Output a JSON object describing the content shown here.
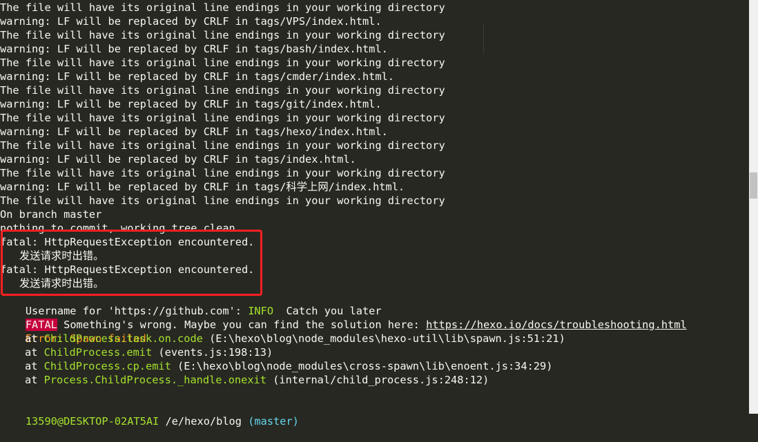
{
  "terminal": {
    "lines": [
      "The file will have its original line endings in your working directory",
      "warning: LF will be replaced by CRLF in tags/VPS/index.html.",
      "The file will have its original line endings in your working directory",
      "warning: LF will be replaced by CRLF in tags/bash/index.html.",
      "The file will have its original line endings in your working directory",
      "warning: LF will be replaced by CRLF in tags/cmder/index.html.",
      "The file will have its original line endings in your working directory",
      "warning: LF will be replaced by CRLF in tags/git/index.html.",
      "The file will have its original line endings in your working directory",
      "warning: LF will be replaced by CRLF in tags/hexo/index.html.",
      "The file will have its original line endings in your working directory",
      "warning: LF will be replaced by CRLF in tags/index.html.",
      "The file will have its original line endings in your working directory",
      "warning: LF will be replaced by CRLF in tags/科学上网/index.html.",
      "The file will have its original line endings in your working directory",
      "On branch master",
      "nothing to commit, working tree clean",
      "fatal: HttpRequestException encountered.",
      "发送请求时出错。",
      "fatal: HttpRequestException encountered.",
      "发送请求时出错。"
    ],
    "username_prompt": "Username for 'https://github.com': ",
    "info_tag": "INFO",
    "info_msg": "  Catch you later",
    "fatal_tag": "FATAL",
    "fatal_msg": " Something's wrong. Maybe you can find the solution here: ",
    "fatal_link": "https://hexo.io/docs/troubleshooting.html",
    "error_label": "Error: Spawn failed",
    "stack": [
      {
        "at": "at ",
        "fn": "ChildProcess.task.on.code",
        "loc": " (E:\\hexo\\blog\\node_modules\\hexo-util\\lib\\spawn.js:51:21)"
      },
      {
        "at": "at ",
        "fn": "ChildProcess.emit",
        "loc": " (events.js:198:13)"
      },
      {
        "at": "at ",
        "fn": "ChildProcess.cp.emit",
        "loc": " (E:\\hexo\\blog\\node_modules\\cross-spawn\\lib\\enoent.js:34:29)"
      },
      {
        "at": "at ",
        "fn": "Process.ChildProcess._handle.onexit",
        "loc": " (internal/child_process.js:248:12)"
      }
    ],
    "prompt_user": "13590@DESKTOP-02AT5AI",
    "prompt_path": " /e/hexo/blog ",
    "prompt_branch": "(master)"
  },
  "colors": {
    "background": "#272822",
    "text": "#f8f8f2",
    "green": "#a6e22e",
    "orange": "#fd971f",
    "blue": "#66d9ef",
    "fatal_bg": "#c6003b",
    "highlight_border": "#ff2020"
  }
}
